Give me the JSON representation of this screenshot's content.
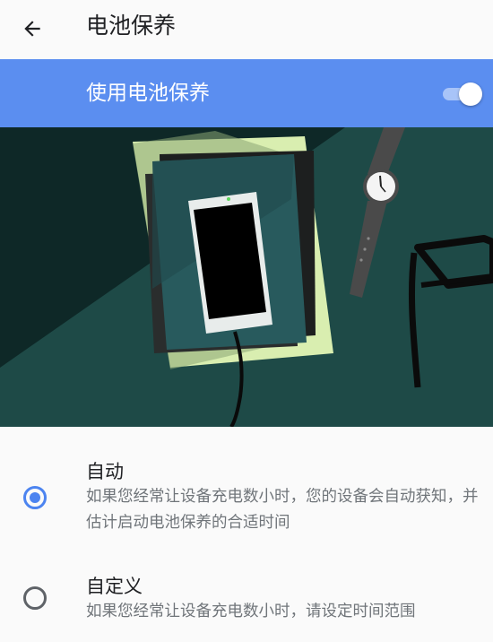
{
  "header": {
    "title": "电池保养"
  },
  "toggle": {
    "label": "使用电池保养",
    "state": "on"
  },
  "options": [
    {
      "title": "自动",
      "description": "如果您经常让设备充电数小时，您的设备会自动获知，并估计启动电池保养的合适时间",
      "selected": true
    },
    {
      "title": "自定义",
      "description": "如果您经常让设备充电数小时，请设定时间范围",
      "selected": false
    }
  ],
  "colors": {
    "accent": "#5b8ef0",
    "radio_selected": "#4c84f0",
    "illustration_bg": "#1e4a47"
  }
}
